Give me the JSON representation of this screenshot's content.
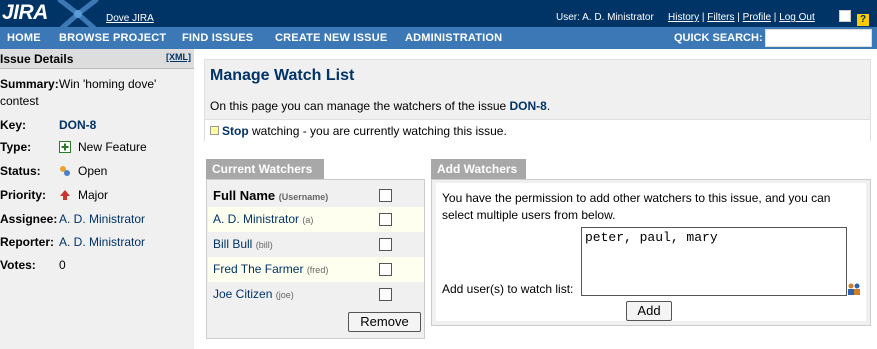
{
  "header": {
    "logo_text": "JIRA",
    "app_name": "Dove JIRA",
    "user_label": "User: A. D. Ministrator",
    "links": [
      "History",
      "Filters",
      "Profile",
      "Log Out"
    ]
  },
  "nav": {
    "items": [
      {
        "label": "HOME"
      },
      {
        "label": "BROWSE PROJECT"
      },
      {
        "label": "FIND ISSUES"
      },
      {
        "label": "CREATE NEW ISSUE"
      },
      {
        "label": "ADMINISTRATION"
      }
    ],
    "quick_search_label": "QUICK SEARCH:"
  },
  "issue_details": {
    "title": "Issue Details",
    "xml_label": "[XML]",
    "summary_label": "Summary:",
    "summary_value_line1": "Win 'homing dove'",
    "summary_value_line2": "contest",
    "key_label": "Key:",
    "key_value": "DON-8",
    "type_label": "Type:",
    "type_value": "New Feature",
    "status_label": "Status:",
    "status_value": "Open",
    "priority_label": "Priority:",
    "priority_value": "Major",
    "assignee_label": "Assignee:",
    "assignee_value": "A. D. Ministrator",
    "reporter_label": "Reporter:",
    "reporter_value": "A. D. Ministrator",
    "votes_label": "Votes:",
    "votes_value": "0"
  },
  "manage": {
    "title": "Manage Watch List",
    "desc_prefix": "On this page you can manage the watchers of the issue ",
    "issue_key": "DON-8",
    "desc_suffix": ".",
    "stop_link": "Stop",
    "stop_text": " watching - you are currently watching this issue."
  },
  "current_watchers": {
    "tab_label": "Current Watchers",
    "header_name": "Full Name",
    "header_user": "(Username)",
    "rows": [
      {
        "name": "A. D. Ministrator",
        "username": "(a)"
      },
      {
        "name": "Bill Bull",
        "username": "(bill)"
      },
      {
        "name": "Fred The Farmer",
        "username": "(fred)"
      },
      {
        "name": "Joe Citizen",
        "username": "(joe)"
      }
    ],
    "remove_label": "Remove"
  },
  "add_watchers": {
    "tab_label": "Add Watchers",
    "description": "You have the permission to add other watchers to this issue, and you can select multiple users from below.",
    "field_label": "Add user(s) to watch list:",
    "field_value": "peter, paul, mary",
    "add_label": "Add"
  },
  "colors": {
    "header_bg": "#003366",
    "nav_bg": "#3c78b5",
    "link": "#003366"
  }
}
